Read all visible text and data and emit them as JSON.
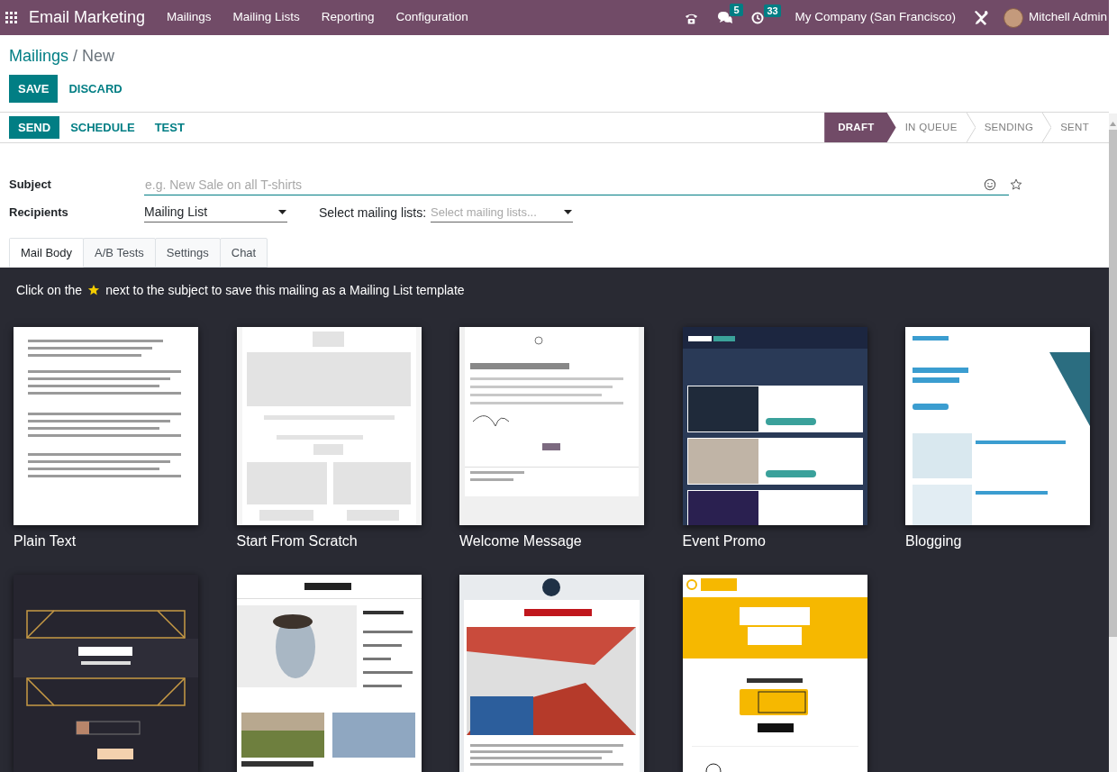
{
  "app": {
    "title": "Email Marketing",
    "menu": [
      "Mailings",
      "Mailing Lists",
      "Reporting",
      "Configuration"
    ]
  },
  "systray": {
    "messages_count": "5",
    "activities_count": "33",
    "company": "My Company (San Francisco)",
    "user": "Mitchell Admin"
  },
  "breadcrumb": [
    "Mailings",
    "New"
  ],
  "breadcrumb_separator": "/",
  "form_buttons": [
    {
      "label": "SAVE",
      "primary": true
    },
    {
      "label": "DISCARD",
      "primary": false
    }
  ],
  "actions": [
    {
      "label": "SEND",
      "primary": true
    },
    {
      "label": "SCHEDULE",
      "primary": false
    },
    {
      "label": "TEST",
      "primary": false
    }
  ],
  "statusbar": [
    {
      "label": "DRAFT",
      "selected": true
    },
    {
      "label": "IN QUEUE",
      "selected": false
    },
    {
      "label": "SENDING",
      "selected": false
    },
    {
      "label": "SENT",
      "selected": false
    }
  ],
  "subject": {
    "label": "Subject",
    "placeholder": "e.g. New Sale on all T-shirts"
  },
  "recipients": {
    "label": "Recipients",
    "value": "Mailing List",
    "lists_label": "Select mailing lists:",
    "lists_placeholder": "Select mailing lists..."
  },
  "tabs": [
    {
      "label": "Mail Body",
      "selected": true
    },
    {
      "label": "A/B Tests",
      "selected": false
    },
    {
      "label": "Settings",
      "selected": false
    },
    {
      "label": "Chat",
      "selected": false
    }
  ],
  "hint": {
    "before": "Click on the",
    "after": "next to the subject to save this mailing as a Mailing List template"
  },
  "templates": [
    {
      "name": "Plain Text",
      "kind": "picture"
    },
    {
      "name": "Start From Scratch",
      "kind": "picture"
    },
    {
      "name": "Welcome Message",
      "kind": "picture"
    },
    {
      "name": "Event Promo",
      "kind": "picture"
    },
    {
      "name": "Blogging",
      "kind": "picture"
    },
    {
      "kind": "picture"
    },
    {
      "kind": "picture"
    },
    {
      "kind": "picture"
    },
    {
      "kind": "picture"
    }
  ]
}
